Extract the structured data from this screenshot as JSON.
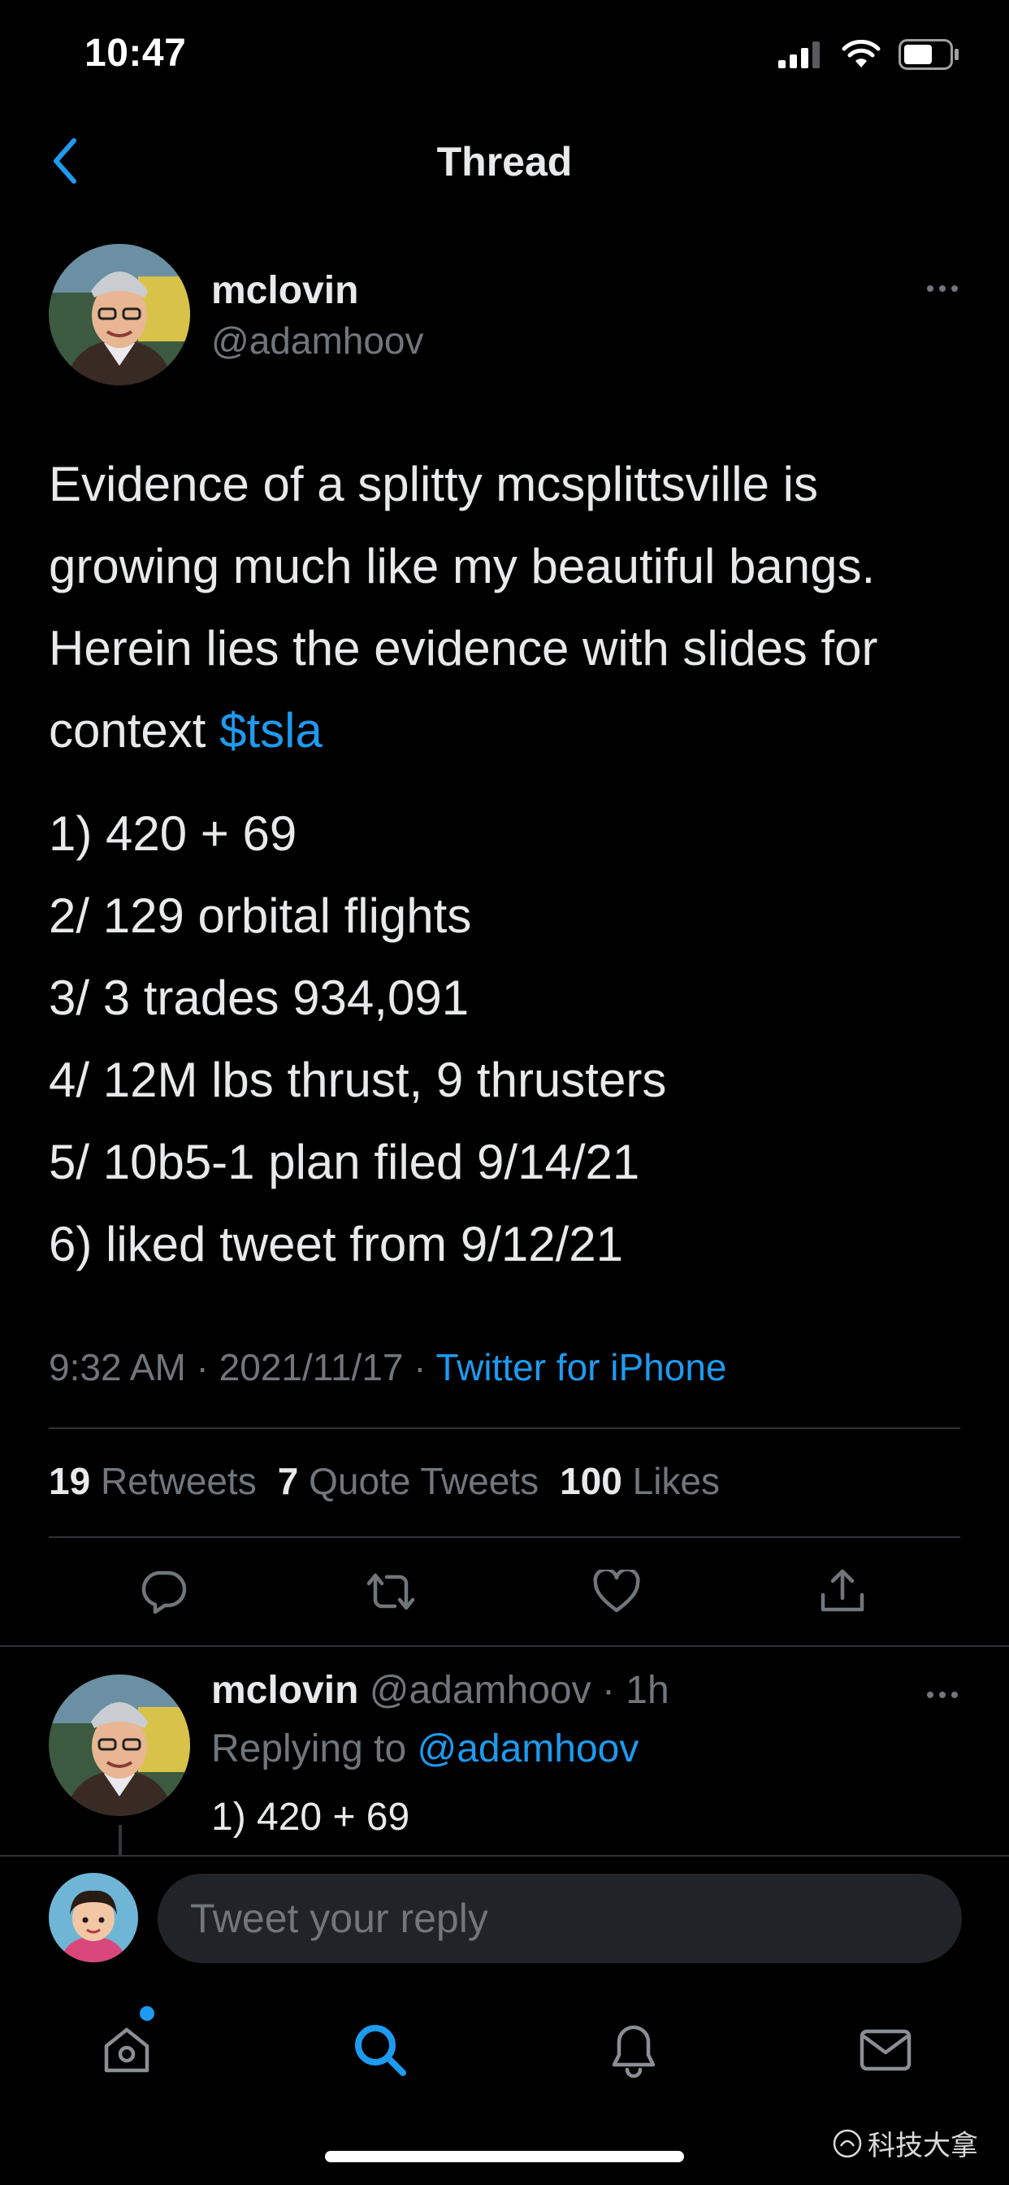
{
  "status_bar": {
    "time": "10:47"
  },
  "nav": {
    "title": "Thread"
  },
  "tweet": {
    "author_name": "mclovin",
    "author_handle": "@adamhoov",
    "body_text": "Evidence of a splitty mcsplittsville is growing much like my beautiful bangs. Herein lies the evidence with slides for context ",
    "cashtag": "$tsla",
    "list": [
      "1) 420 + 69",
      "2/ 129 orbital flights",
      "3/ 3 trades 934,091",
      "4/ 12M lbs thrust, 9 thrusters",
      "5/ 10b5-1 plan filed 9/14/21",
      "6) liked tweet from 9/12/21"
    ],
    "time": "9:32 AM",
    "separator": " · ",
    "date": "2021/11/17",
    "source": "Twitter for iPhone",
    "retweets_count": "19",
    "retweets_label": "Retweets",
    "quotes_count": "7",
    "quotes_label": "Quote Tweets",
    "likes_count": "100",
    "likes_label": "Likes"
  },
  "reply": {
    "author_name": "mclovin",
    "author_handle": "@adamhoov",
    "separator": " · ",
    "age": "1h",
    "replying_prefix": "Replying to ",
    "replying_to": "@adamhoov",
    "text": "1) 420 + 69"
  },
  "composer": {
    "placeholder": "Tweet your reply"
  },
  "watermark": {
    "text": "科技大拿"
  },
  "colors": {
    "accent": "#1d9bf0",
    "muted": "#71767b",
    "background": "#000000",
    "divider": "#2f3336"
  }
}
